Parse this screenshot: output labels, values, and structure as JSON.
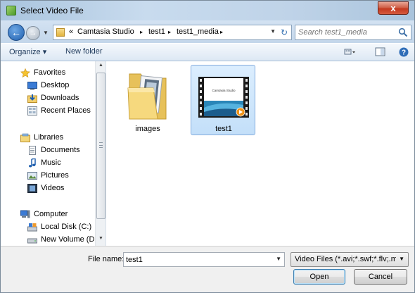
{
  "window": {
    "title": "Select Video File",
    "close_label": "x"
  },
  "address": {
    "breadcrumbs": [
      {
        "label": "«"
      },
      {
        "label": "Camtasia Studio"
      },
      {
        "label": "test1"
      },
      {
        "label": "test1_media"
      }
    ],
    "separator": "▸"
  },
  "search": {
    "placeholder": "Search test1_media"
  },
  "toolbar": {
    "organize_label": "Organize ▾",
    "new_folder_label": "New folder"
  },
  "nav": {
    "favorites": {
      "label": "Favorites",
      "items": [
        {
          "label": "Desktop",
          "icon": "desktop-icon"
        },
        {
          "label": "Downloads",
          "icon": "downloads-icon"
        },
        {
          "label": "Recent Places",
          "icon": "recent-places-icon"
        }
      ]
    },
    "libraries": {
      "label": "Libraries",
      "items": [
        {
          "label": "Documents",
          "icon": "documents-icon"
        },
        {
          "label": "Music",
          "icon": "music-icon"
        },
        {
          "label": "Pictures",
          "icon": "pictures-icon"
        },
        {
          "label": "Videos",
          "icon": "videos-icon"
        }
      ]
    },
    "computer": {
      "label": "Computer",
      "items": [
        {
          "label": "Local Disk (C:)",
          "icon": "local-disk-icon"
        },
        {
          "label": "New Volume (D:)",
          "icon": "drive-icon"
        }
      ]
    }
  },
  "files": [
    {
      "name": "images",
      "type": "folder",
      "selected": false
    },
    {
      "name": "test1",
      "type": "video",
      "selected": true,
      "thumbnail_text": "Camtasia Studio"
    }
  ],
  "footer": {
    "file_name_label": "File name:",
    "file_name_value": "test1",
    "file_type_value": "Video Files (*.avi;*.swf;*.flv;.mp",
    "open_label": "Open",
    "cancel_label": "Cancel"
  }
}
